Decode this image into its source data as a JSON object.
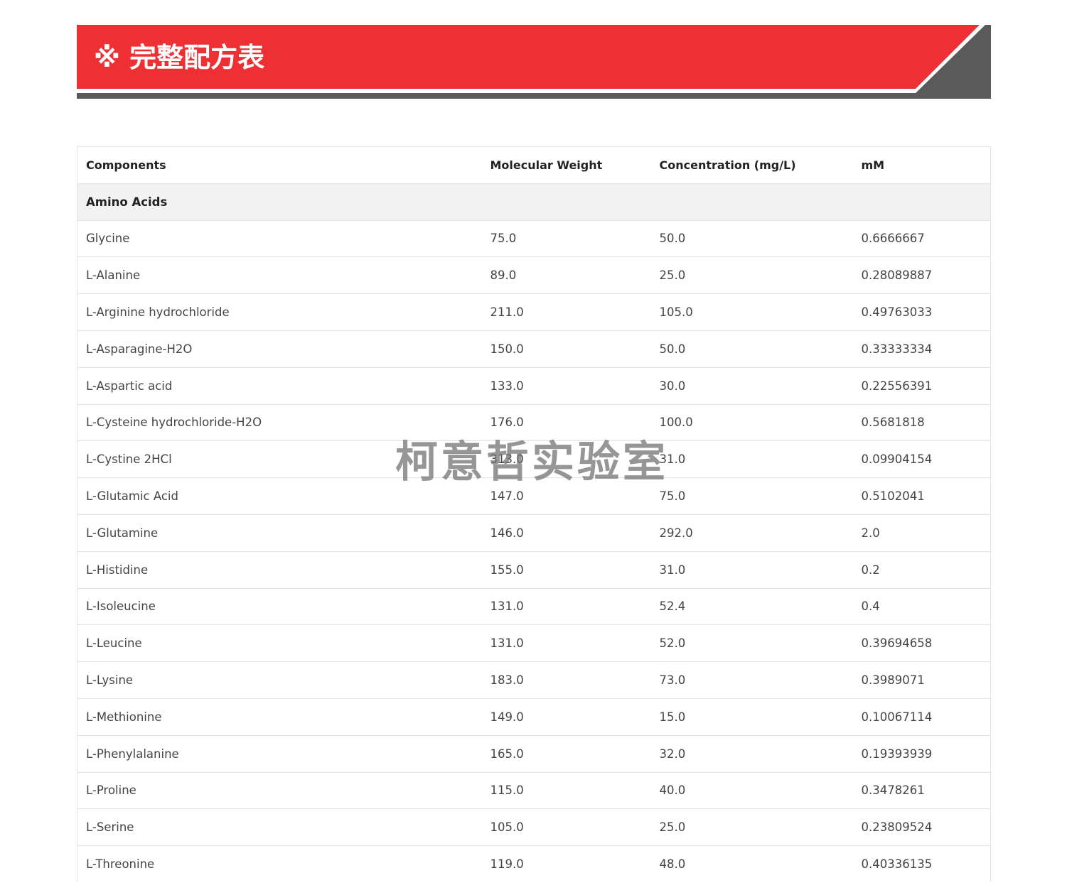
{
  "colors": {
    "banner_red": "#ee3035",
    "banner_dark": "#5a5a5a",
    "section_bg": "#f2f2f2"
  },
  "banner": {
    "title": "※ 完整配方表"
  },
  "table": {
    "headers": [
      "Components",
      "Molecular Weight",
      "Concentration (mg/L)",
      "mM"
    ],
    "section_title": "Amino Acids",
    "rows": [
      [
        "Glycine",
        "75.0",
        "50.0",
        "0.6666667"
      ],
      [
        "L-Alanine",
        "89.0",
        "25.0",
        "0.28089887"
      ],
      [
        "L-Arginine hydrochloride",
        "211.0",
        "105.0",
        "0.49763033"
      ],
      [
        "L-Asparagine-H2O",
        "150.0",
        "50.0",
        "0.33333334"
      ],
      [
        "L-Aspartic acid",
        "133.0",
        "30.0",
        "0.22556391"
      ],
      [
        "L-Cysteine hydrochloride-H2O",
        "176.0",
        "100.0",
        "0.5681818"
      ],
      [
        "L-Cystine 2HCl",
        "313.0",
        "31.0",
        "0.09904154"
      ],
      [
        "L-Glutamic Acid",
        "147.0",
        "75.0",
        "0.5102041"
      ],
      [
        "L-Glutamine",
        "146.0",
        "292.0",
        "2.0"
      ],
      [
        "L-Histidine",
        "155.0",
        "31.0",
        "0.2"
      ],
      [
        "L-Isoleucine",
        "131.0",
        "52.4",
        "0.4"
      ],
      [
        "L-Leucine",
        "131.0",
        "52.0",
        "0.39694658"
      ],
      [
        "L-Lysine",
        "183.0",
        "73.0",
        "0.3989071"
      ],
      [
        "L-Methionine",
        "149.0",
        "15.0",
        "0.10067114"
      ],
      [
        "L-Phenylalanine",
        "165.0",
        "32.0",
        "0.19393939"
      ],
      [
        "L-Proline",
        "115.0",
        "40.0",
        "0.3478261"
      ],
      [
        "L-Serine",
        "105.0",
        "25.0",
        "0.23809524"
      ],
      [
        "L-Threonine",
        "119.0",
        "48.0",
        "0.40336135"
      ]
    ]
  },
  "watermark": {
    "text": "柯意哲实验室"
  }
}
